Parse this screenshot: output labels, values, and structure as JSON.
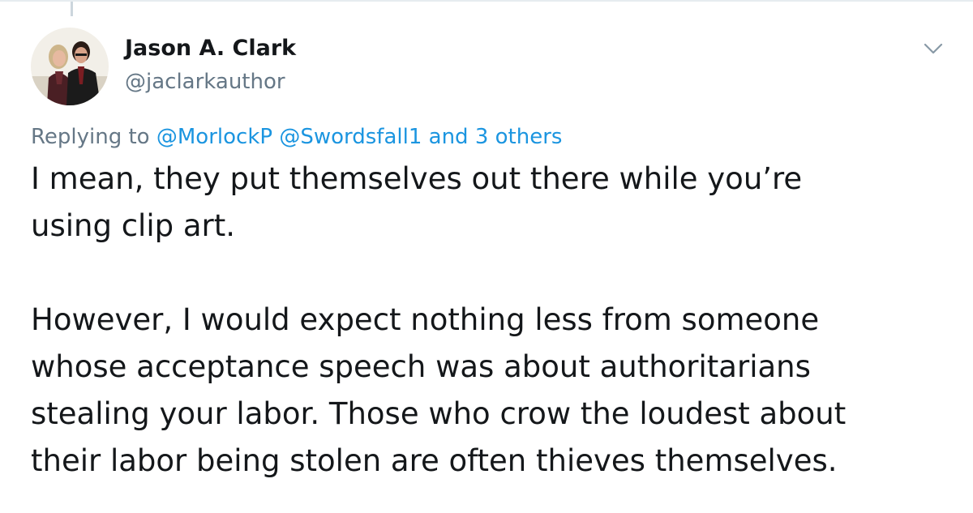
{
  "tweet": {
    "author": {
      "display_name": "Jason A. Clark",
      "handle": "@jaclarkauthor",
      "avatar_icon": "profile-photo"
    },
    "menu_icon": "chevron-down-icon",
    "reply": {
      "prefix": "Replying to",
      "mention_1": "@MorlockP",
      "mention_2": "@Swordsfall1",
      "others": "and 3 others"
    },
    "text": {
      "paragraph_1_line_1": "I mean, they put themselves out there while you’re",
      "paragraph_1_line_2": "using clip art.",
      "paragraph_2_line_1": "However, I would expect nothing less from someone",
      "paragraph_2_line_2": "whose acceptance speech was about authoritarians",
      "paragraph_2_line_3": "stealing your labor. Those who crow the loudest about",
      "paragraph_2_line_4": "their labor being stolen are often thieves themselves."
    },
    "colors": {
      "link": "#1b95e0",
      "secondary_text": "#657786",
      "primary_text": "#14171a",
      "border": "#e6ecf0"
    }
  }
}
